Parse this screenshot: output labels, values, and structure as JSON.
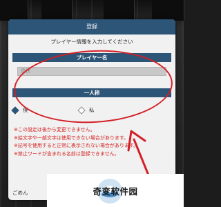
{
  "dialog": {
    "title": "登録",
    "instruction": "プレイヤー情報を入力してください",
    "name_section": "プレイヤー名",
    "name_value": "島快",
    "pronoun_section": "一人称",
    "pronoun_options": [
      {
        "label": "僕",
        "selected": true
      },
      {
        "label": "私",
        "selected": false
      }
    ],
    "notes": [
      "※この設定は後から変更できません。",
      "※絵文字や一部文字は使用できない場合があります。",
      "※記号を使用すると正常に表示されない場合があります。",
      "※禁止ワードが含まれる名前は登録できません。"
    ],
    "footer_left": "ごめん"
  },
  "watermark": {
    "text": "奇变软件园"
  },
  "colors": {
    "header": "#2d5577",
    "warning": "#d62020",
    "annotation": "#d32028"
  }
}
